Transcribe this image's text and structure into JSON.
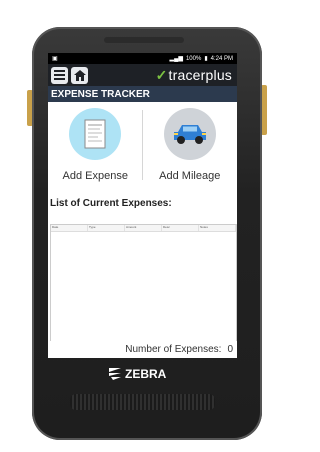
{
  "statusbar": {
    "left_icons": "▣",
    "battery": "100%",
    "time": "4:24 PM"
  },
  "appbar": {
    "brand": "tracerplus"
  },
  "title": "EXPENSE TRACKER",
  "actions": [
    {
      "label": "Add Expense"
    },
    {
      "label": "Add Mileage"
    }
  ],
  "list": {
    "heading": "List of Current Expenses:",
    "columns": [
      "Date",
      "Type",
      "Amount",
      "Desc",
      "Notes"
    ]
  },
  "footer": {
    "label": "Number of Expenses:",
    "count": "0"
  },
  "device": {
    "brand": "ZEBRA"
  },
  "colors": {
    "appbar": "#1e2126",
    "titlebar": "#2c3a4e",
    "accent": "#7cc242",
    "car_circle": "#cfd3d8",
    "expense_circle": "#aee3f5"
  }
}
